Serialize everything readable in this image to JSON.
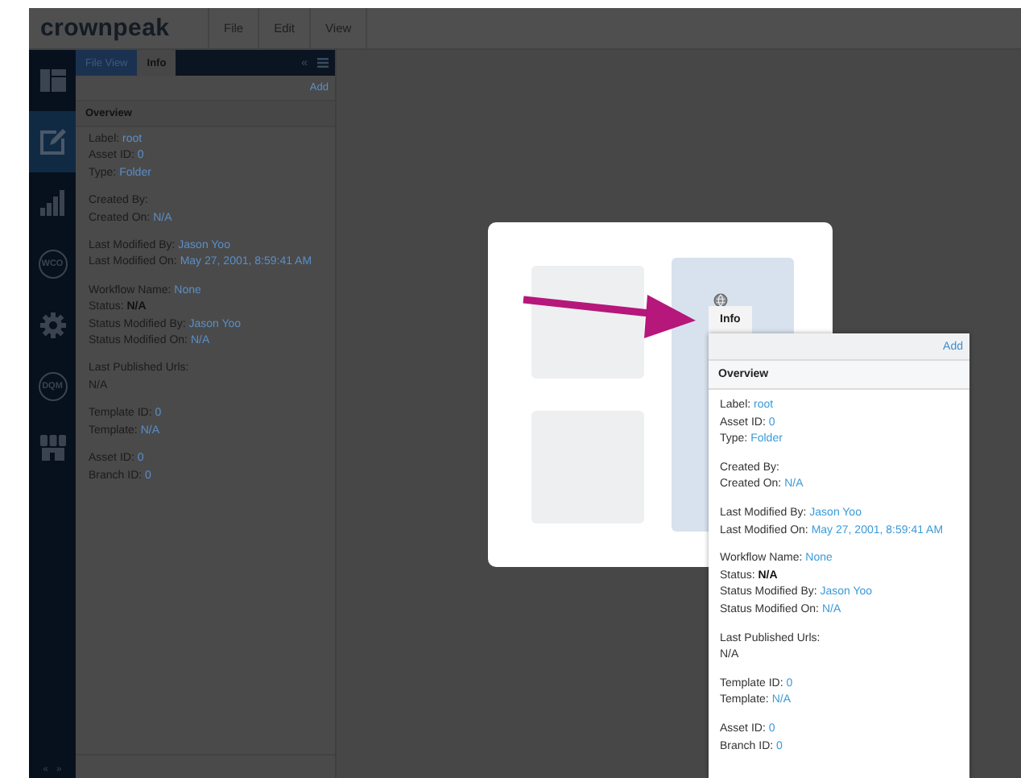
{
  "topbar": {
    "logo": "crownpeak",
    "menus": [
      "File",
      "Edit",
      "View"
    ]
  },
  "rail": {
    "items": [
      {
        "kind": "layout",
        "selected": false
      },
      {
        "kind": "edit",
        "selected": true
      },
      {
        "kind": "chart",
        "selected": false
      },
      {
        "kind": "badge",
        "text": "WCO",
        "selected": false
      },
      {
        "kind": "gear",
        "selected": false
      },
      {
        "kind": "badge",
        "text": "DQM",
        "selected": false
      },
      {
        "kind": "store",
        "selected": false
      }
    ],
    "footer": [
      "«",
      "»"
    ]
  },
  "panel": {
    "tabs": [
      {
        "label": "File View",
        "selected": false
      },
      {
        "label": "Info",
        "selected": true
      }
    ],
    "collapse": "«",
    "add": "Add",
    "section": "Overview",
    "groups": [
      [
        {
          "label": "Label:",
          "value": "root",
          "kind": "link"
        },
        {
          "label": "Asset ID:",
          "value": "0",
          "kind": "link"
        },
        {
          "label": "Type:",
          "value": "Folder",
          "kind": "link"
        }
      ],
      [
        {
          "label": "Created By:",
          "kind": "label_only"
        },
        {
          "label": "Created On:",
          "value": "N/A",
          "kind": "link"
        }
      ],
      [
        {
          "label": "Last Modified By:",
          "value": "Jason Yoo",
          "kind": "link"
        },
        {
          "label": "Last Modified On:",
          "value": "May 27, 2001, 8:59:41 AM",
          "kind": "link"
        }
      ],
      [
        {
          "label": "Workflow Name:",
          "value": "None",
          "kind": "link"
        },
        {
          "label": "Status:",
          "value": "N/A",
          "kind": "strong"
        },
        {
          "label": "Status Modified By:",
          "value": "Jason Yoo",
          "kind": "link"
        },
        {
          "label": "Status Modified On:",
          "value": "N/A",
          "kind": "link"
        }
      ],
      [
        {
          "label": "Last Published Urls:",
          "value": "N/A",
          "kind": "below"
        }
      ],
      [
        {
          "label": "Template ID:",
          "value": "0",
          "kind": "link"
        },
        {
          "label": "Template:",
          "value": "N/A",
          "kind": "link"
        }
      ],
      [
        {
          "label": "Asset ID:",
          "value": "0",
          "kind": "link"
        },
        {
          "label": "Branch ID:",
          "value": "0",
          "kind": "link"
        }
      ]
    ]
  },
  "callout": {
    "tab": {
      "label": "Info",
      "selected": true
    },
    "add": "Add",
    "section": "Overview",
    "groups": [
      [
        {
          "label": "Label:",
          "value": "root",
          "kind": "link"
        },
        {
          "label": "Asset ID:",
          "value": "0",
          "kind": "link"
        },
        {
          "label": "Type:",
          "value": "Folder",
          "kind": "link"
        }
      ],
      [
        {
          "label": "Created By:",
          "kind": "label_only"
        },
        {
          "label": "Created On:",
          "value": "N/A",
          "kind": "link"
        }
      ],
      [
        {
          "label": "Last Modified By:",
          "value": "Jason Yoo",
          "kind": "link"
        },
        {
          "label": "Last Modified On:",
          "value": "May 27, 2001, 8:59:41 AM",
          "kind": "link"
        }
      ],
      [
        {
          "label": "Workflow Name:",
          "value": "None",
          "kind": "link"
        },
        {
          "label": "Status:",
          "value": "N/A",
          "kind": "strong"
        },
        {
          "label": "Status Modified By:",
          "value": "Jason Yoo",
          "kind": "link"
        },
        {
          "label": "Status Modified On:",
          "value": "N/A",
          "kind": "link"
        }
      ],
      [
        {
          "label": "Last Published Urls:",
          "value": "N/A",
          "kind": "below"
        }
      ],
      [
        {
          "label": "Template ID:",
          "value": "0",
          "kind": "link"
        },
        {
          "label": "Template:",
          "value": "N/A",
          "kind": "link"
        }
      ],
      [
        {
          "label": "Asset ID:",
          "value": "0",
          "kind": "link"
        },
        {
          "label": "Branch ID:",
          "value": "0",
          "kind": "link"
        }
      ]
    ]
  }
}
